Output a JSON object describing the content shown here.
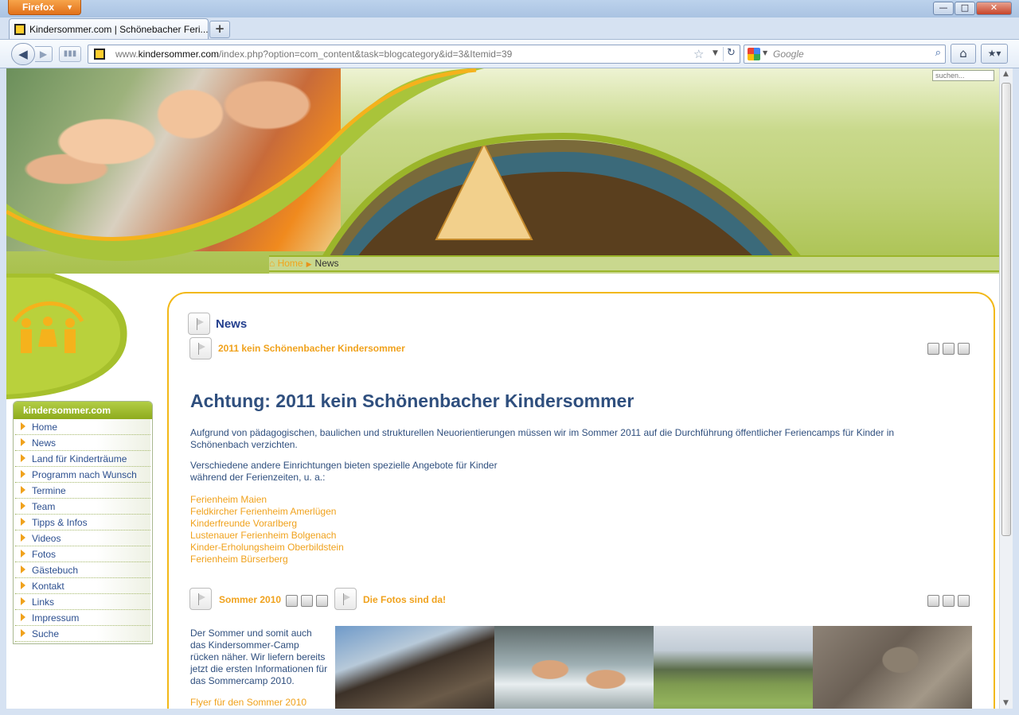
{
  "browser": {
    "menu_button": "Firefox",
    "tab_title": "Kindersommer.com | Schönebacher Feri...",
    "new_tab": "+",
    "url_prefix": "www.",
    "url_domain": "kindersommer.com",
    "url_path": "/index.php?option=com_content&task=blogcategory&id=3&Itemid=39",
    "search_placeholder": "Google",
    "window_buttons": {
      "min": "—",
      "max": "□",
      "close": "✕"
    }
  },
  "header": {
    "search_placeholder": "suchen...",
    "breadcrumb": {
      "home": "Home",
      "current": "News"
    }
  },
  "sidebar": {
    "title": "kindersommer.com",
    "items": [
      {
        "label": "Home"
      },
      {
        "label": "News"
      },
      {
        "label": "Land für Kinderträume"
      },
      {
        "label": "Programm nach Wunsch"
      },
      {
        "label": "Termine"
      },
      {
        "label": "Team"
      },
      {
        "label": "Tipps & Infos"
      },
      {
        "label": "Videos"
      },
      {
        "label": "Fotos"
      },
      {
        "label": "Gästebuch"
      },
      {
        "label": "Kontakt"
      },
      {
        "label": "Links"
      },
      {
        "label": "Impressum"
      },
      {
        "label": "Suche"
      }
    ]
  },
  "main": {
    "section_title": "News",
    "article1": {
      "link": "2011 kein Schönenbacher Kindersommer",
      "heading": "Achtung: 2011 kein Schönenbacher Kindersommer",
      "para1": "Aufgrund von pädagogischen, baulichen und strukturellen Neuorientierungen müssen wir im Sommer 2011 auf die Durchführung öffentlicher Feriencamps für Kinder in Schönenbach verzichten.",
      "para2_line1": "Verschiedene andere Einrichtungen bieten spezielle Angebote für Kinder",
      "para2_line2": "während der Ferienzeiten, u. a.:",
      "links": [
        "Ferienheim Maien",
        "Feldkircher Ferienheim Amerlügen",
        "Kinderfreunde Vorarlberg",
        "Lustenauer Ferienheim Bolgenach",
        "Kinder-Erholungsheim Oberbildstein",
        "Ferienheim Bürserberg"
      ]
    },
    "article2": {
      "link": "Sommer 2010",
      "text_lines": [
        "Der Sommer und somit auch",
        "das Kindersommer-Camp",
        "rücken näher. Wir liefern bereits",
        "jetzt die ersten Informationen für",
        "das Sommercamp 2010."
      ],
      "flyer_link": "Flyer für den Sommer 2010"
    },
    "article3": {
      "link": "Die Fotos sind da!"
    }
  },
  "colors": {
    "accent": "#f0a21d",
    "green": "#9ab52a",
    "text": "#2f4f7e"
  }
}
